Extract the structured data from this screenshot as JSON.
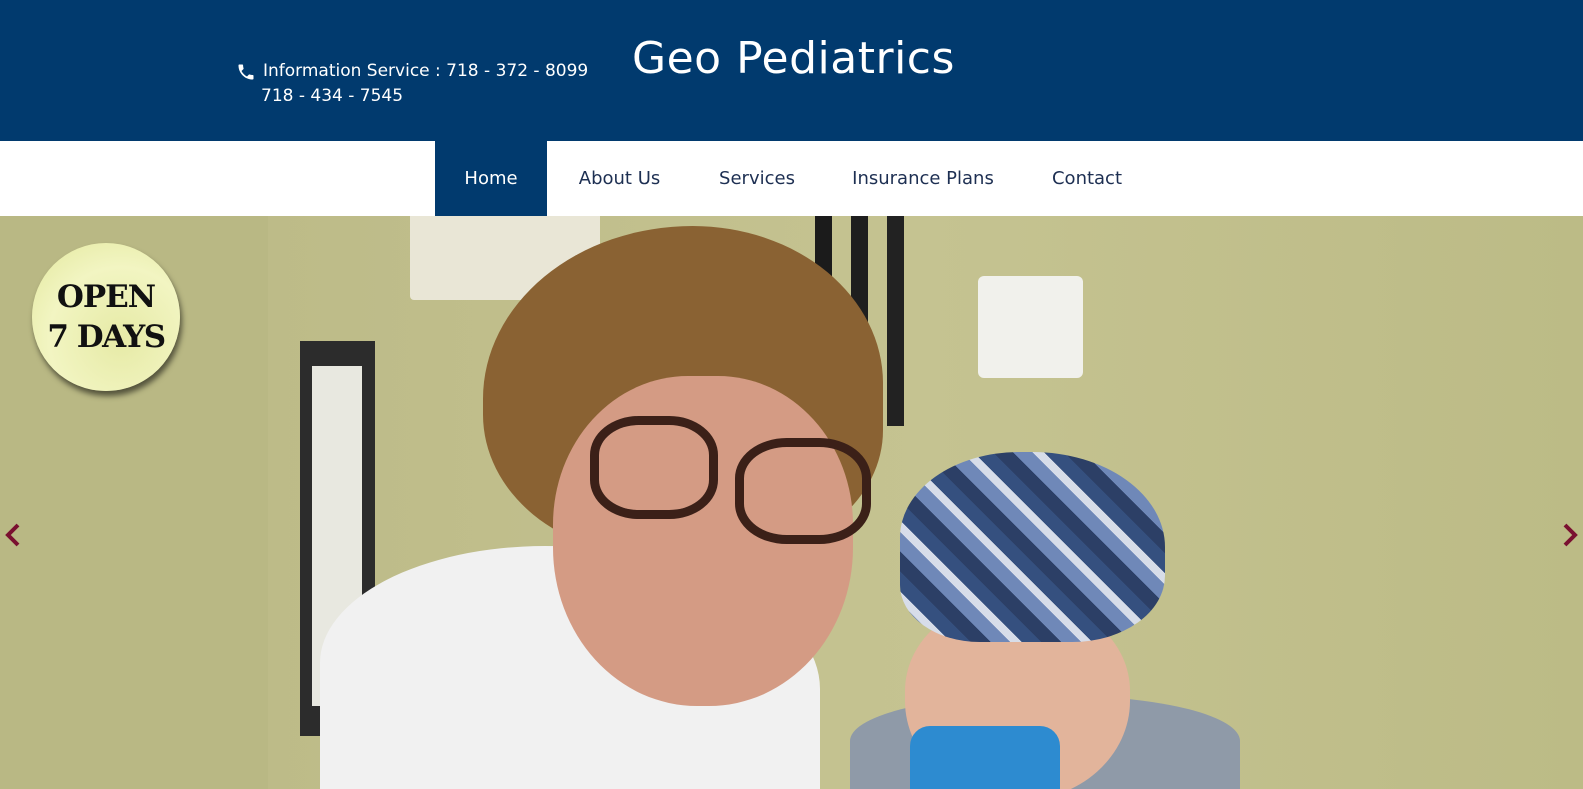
{
  "header": {
    "phone_label": "Information Service : 718 - 372 - 8099",
    "phone_alt": "718 - 434 - 7545",
    "brand": "Geo Pediatrics"
  },
  "nav": {
    "items": [
      {
        "label": "Home",
        "active": true
      },
      {
        "label": "About Us",
        "active": false
      },
      {
        "label": "Services",
        "active": false
      },
      {
        "label": "Insurance Plans",
        "active": false
      },
      {
        "label": "Contact",
        "active": false
      }
    ]
  },
  "hero": {
    "badge_line1": "OPEN",
    "badge_line2": "7 DAYS",
    "prev_icon": "chevron-left-icon",
    "next_icon": "chevron-right-icon"
  },
  "colors": {
    "header_bg": "#013a6e",
    "nav_text": "#1d2f52",
    "arrow": "#7a1030"
  }
}
